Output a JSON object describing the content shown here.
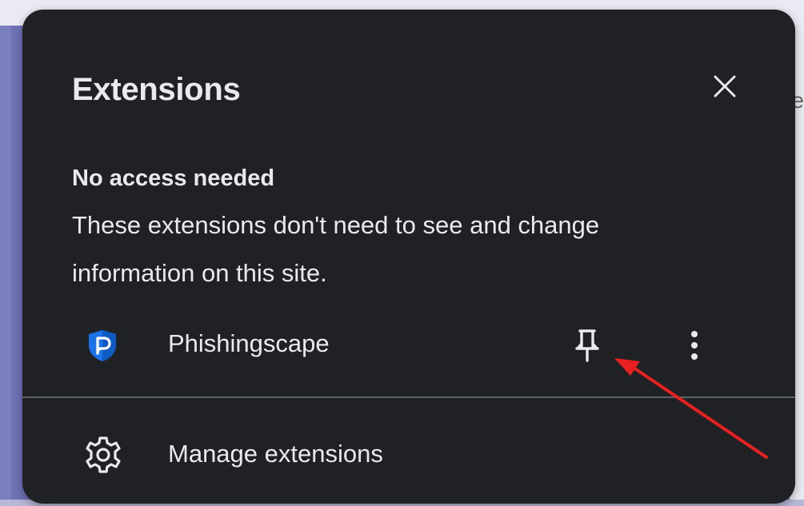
{
  "popup": {
    "title": "Extensions",
    "section_heading": "No access needed",
    "section_description": "These extensions don't need to see and change information on this site.",
    "extensions": [
      {
        "name": "Phishingscape",
        "icon": "phishingscape-shield-icon",
        "pin_icon": "pin-icon",
        "more_icon": "more-vert-icon"
      }
    ],
    "manage_label": "Manage extensions",
    "manage_icon": "gear-icon",
    "close_icon": "close-icon"
  },
  "annotation": {
    "arrow_color": "#e8201f"
  },
  "colors": {
    "popup_bg": "#202124",
    "text": "#e8eaed",
    "divider": "#5f6368",
    "ext_icon_blue": "#1a73e8"
  },
  "background": {
    "visible_text": "e"
  }
}
